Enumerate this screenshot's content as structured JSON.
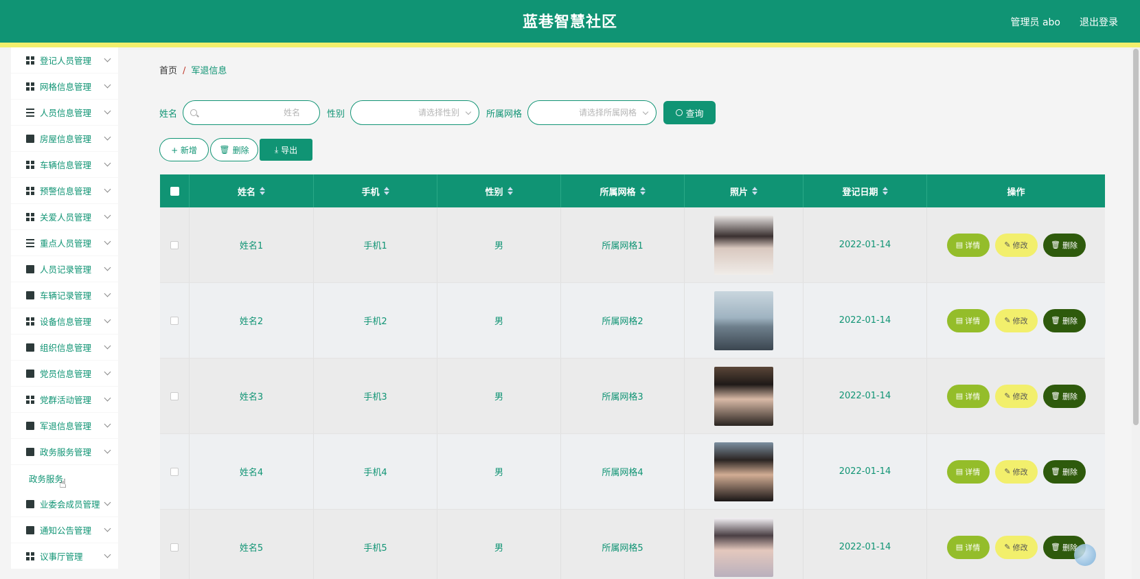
{
  "header": {
    "title": "蓝巷智慧社区",
    "user": "管理员 abo",
    "logout": "退出登录"
  },
  "sidebar": {
    "items": [
      {
        "label": "登记人员管理",
        "icon": "grid-icon"
      },
      {
        "label": "网格信息管理",
        "icon": "grid-icon"
      },
      {
        "label": "人员信息管理",
        "icon": "sliders-icon"
      },
      {
        "label": "房屋信息管理",
        "icon": "monitor-icon"
      },
      {
        "label": "车辆信息管理",
        "icon": "grid-icon"
      },
      {
        "label": "预警信息管理",
        "icon": "grid-icon"
      },
      {
        "label": "关爱人员管理",
        "icon": "grid-icon"
      },
      {
        "label": "重点人员管理",
        "icon": "list-icon"
      },
      {
        "label": "人员记录管理",
        "icon": "clipboard-icon"
      },
      {
        "label": "车辆记录管理",
        "icon": "ticket-icon"
      },
      {
        "label": "设备信息管理",
        "icon": "grid-icon"
      },
      {
        "label": "组织信息管理",
        "icon": "clipboard-check-icon"
      },
      {
        "label": "党员信息管理",
        "icon": "wallet-icon"
      },
      {
        "label": "党群活动管理",
        "icon": "grid-icon"
      },
      {
        "label": "军退信息管理",
        "icon": "briefcase-icon"
      },
      {
        "label": "政务服务管理",
        "icon": "monitor-icon"
      }
    ],
    "sub_item": "政务服务",
    "items_after": [
      {
        "label": "业委会成员管理",
        "icon": "chart-icon"
      },
      {
        "label": "通知公告管理",
        "icon": "line-chart-icon"
      },
      {
        "label": "议事厅管理",
        "icon": "grid-icon"
      }
    ]
  },
  "breadcrumb": {
    "home": "首页",
    "sep": "/",
    "current": "军退信息"
  },
  "search": {
    "name_label": "姓名",
    "name_placeholder": "姓名",
    "gender_label": "性别",
    "gender_placeholder": "请选择性别",
    "grid_label": "所属网格",
    "grid_placeholder": "请选择所属网格",
    "query_button": "查询"
  },
  "actions": {
    "add": "+ 新增",
    "delete": "删除",
    "export": "导出"
  },
  "table": {
    "columns": [
      "姓名",
      "手机",
      "性别",
      "所属网格",
      "照片",
      "登记日期",
      "操作"
    ],
    "rows": [
      {
        "name": "姓名1",
        "phone": "手机1",
        "gender": "男",
        "grid": "所属网格1",
        "date": "2022-01-14"
      },
      {
        "name": "姓名2",
        "phone": "手机2",
        "gender": "男",
        "grid": "所属网格2",
        "date": "2022-01-14"
      },
      {
        "name": "姓名3",
        "phone": "手机3",
        "gender": "男",
        "grid": "所属网格3",
        "date": "2022-01-14"
      },
      {
        "name": "姓名4",
        "phone": "手机4",
        "gender": "男",
        "grid": "所属网格4",
        "date": "2022-01-14"
      },
      {
        "name": "姓名5",
        "phone": "手机5",
        "gender": "男",
        "grid": "所属网格5",
        "date": "2022-01-14"
      }
    ],
    "op_labels": {
      "detail": "详情",
      "edit": "修改",
      "delete": "删除"
    }
  },
  "colors": {
    "primary": "#109474",
    "accent_yellow": "#f2ef6c",
    "detail": "#94bd2a",
    "delete": "#2e5a0c"
  }
}
